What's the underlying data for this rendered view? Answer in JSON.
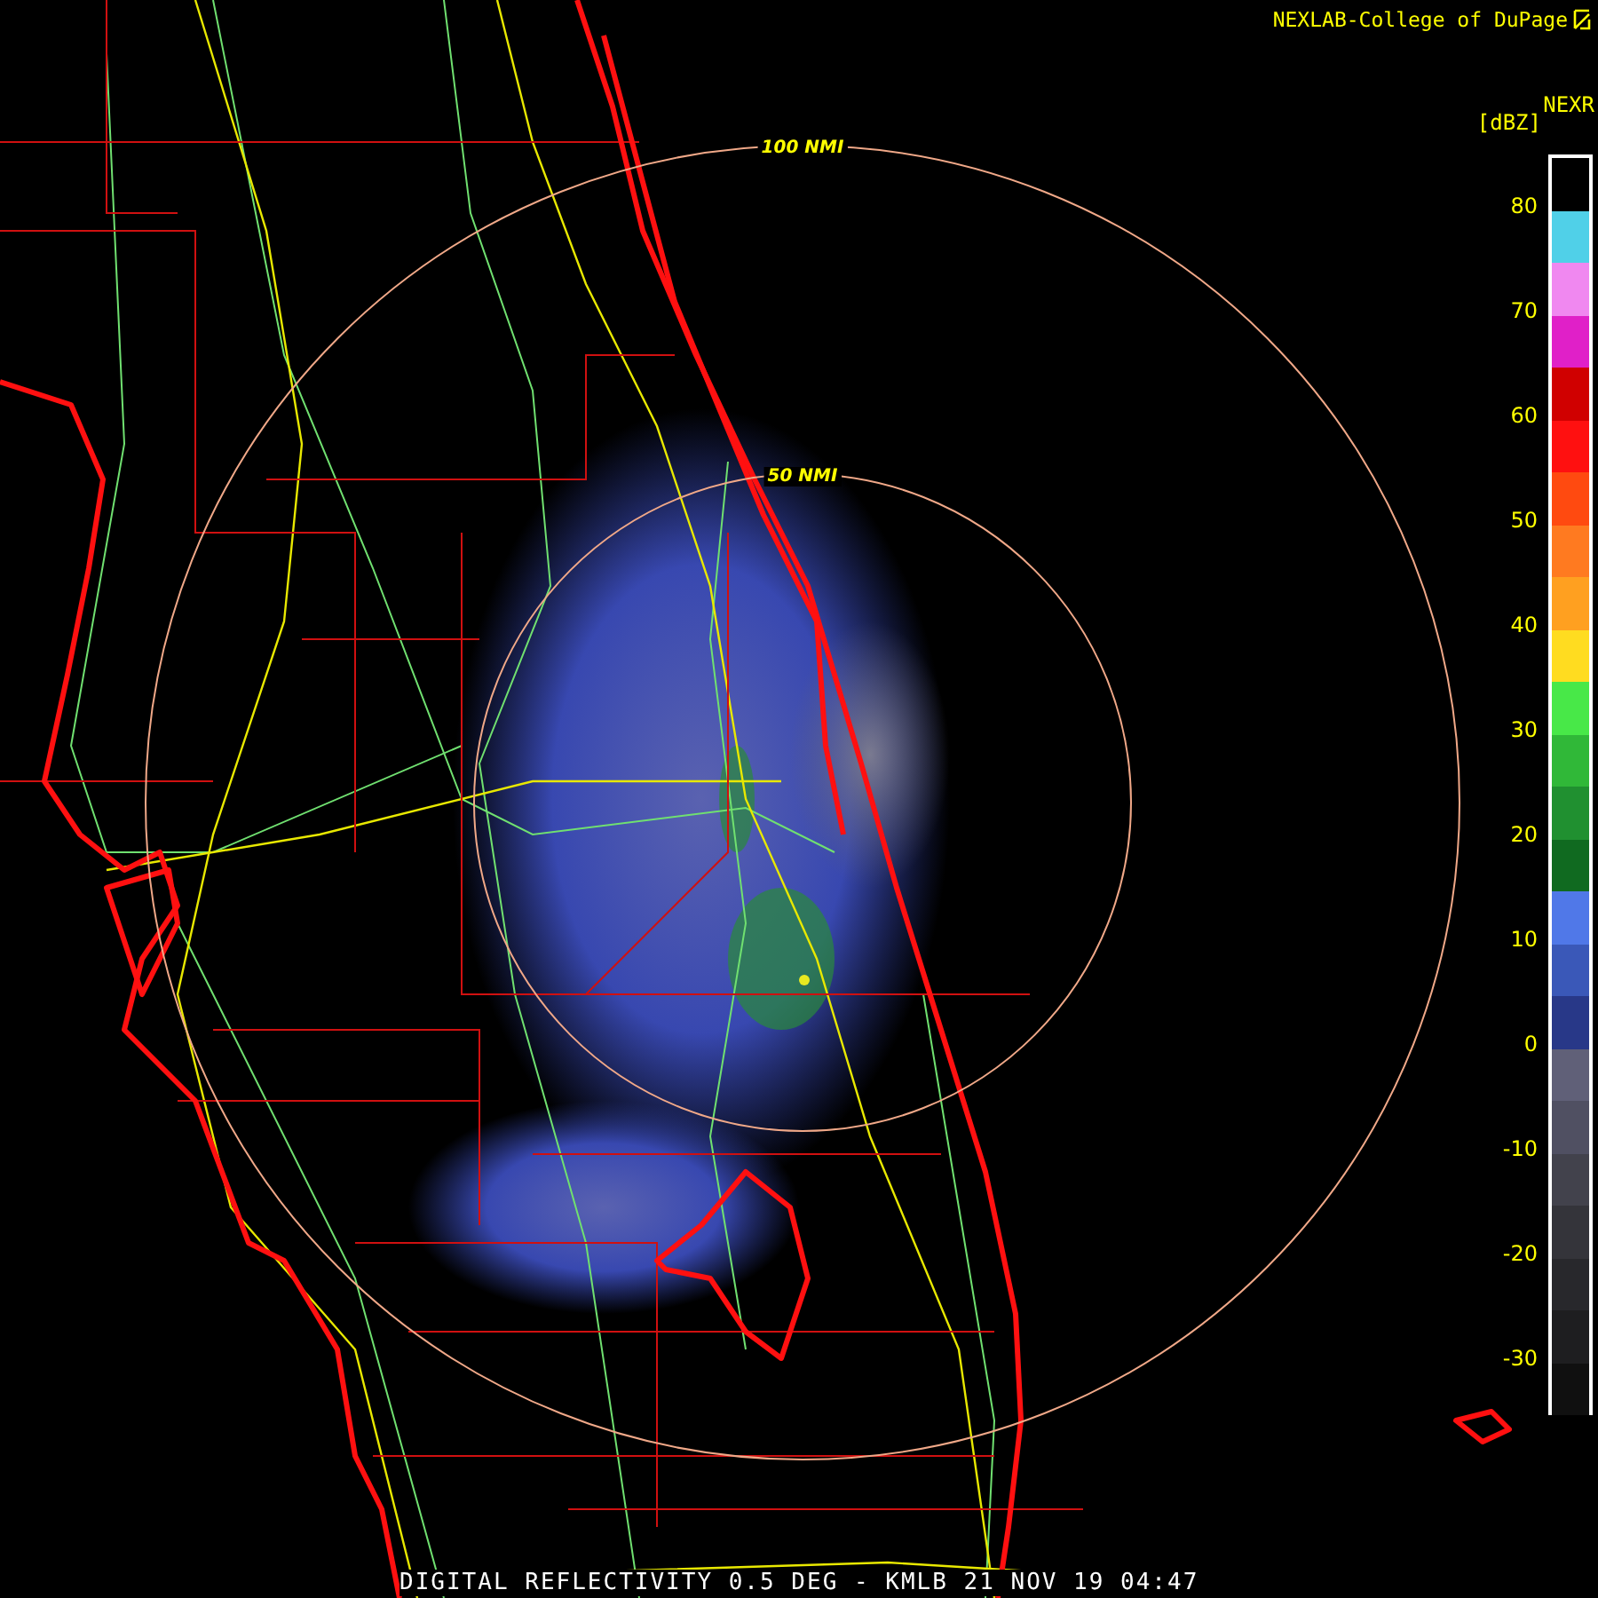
{
  "header": {
    "credit": "NEXLAB-College of DuPage",
    "product": "NEXR",
    "unit": "[dBZ]"
  },
  "range_rings": [
    {
      "label": "100 NMI"
    },
    {
      "label": "50 NMI"
    }
  ],
  "scale": {
    "labels": [
      "80",
      "70",
      "60",
      "50",
      "40",
      "30",
      "20",
      "10",
      "0",
      "-10",
      "-20",
      "-30"
    ],
    "bands": [
      {
        "color": "#000000"
      },
      {
        "color": "#50d0e8"
      },
      {
        "color": "#f088f0"
      },
      {
        "color": "#e020c8"
      },
      {
        "color": "#d00000"
      },
      {
        "color": "#ff1010"
      },
      {
        "color": "#ff4a10"
      },
      {
        "color": "#ff7a20"
      },
      {
        "color": "#ffa020"
      },
      {
        "color": "#ffdc20"
      },
      {
        "color": "#48e848"
      },
      {
        "color": "#30b838"
      },
      {
        "color": "#209030"
      },
      {
        "color": "#106a20"
      },
      {
        "color": "#5078e8"
      },
      {
        "color": "#3a58b8"
      },
      {
        "color": "#283888"
      },
      {
        "color": "#606078"
      },
      {
        "color": "#505062"
      },
      {
        "color": "#42424c"
      },
      {
        "color": "#34343a"
      },
      {
        "color": "#28282c"
      },
      {
        "color": "#1e1e20"
      },
      {
        "color": "#101010"
      }
    ]
  },
  "caption": "DIGITAL REFLECTIVITY 0.5 DEG - KMLB 21 NOV 19 04:47"
}
